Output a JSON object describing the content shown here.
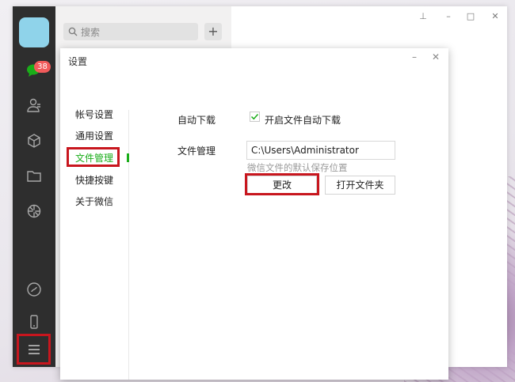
{
  "chat_list": {
    "search_placeholder": "搜索",
    "add_label": "+"
  },
  "sidebar": {
    "unread_badge": "38"
  },
  "window": {
    "pin_label": "⊥",
    "min_label": "–",
    "max_label": "□",
    "close_label": "✕"
  },
  "settings": {
    "title": "设置",
    "minimize": "–",
    "close": "✕",
    "nav": [
      "帐号设置",
      "通用设置",
      "文件管理",
      "快捷按键",
      "关于微信"
    ],
    "active_nav": 2,
    "auto_download_label": "自动下载",
    "auto_download_option": "开启文件自动下载",
    "auto_download_checked": true,
    "file_mgmt_label": "文件管理",
    "save_path": "C:\\Users\\Administrator",
    "save_path_hint": "微信文件的默认保存位置",
    "change_button": "更改",
    "open_folder_button": "打开文件夹"
  },
  "colors": {
    "accent_green": "#1aad19",
    "highlight_red": "#c8161e",
    "sidebar_dark": "#2e2e2e",
    "badge_red": "#f15b5b"
  }
}
